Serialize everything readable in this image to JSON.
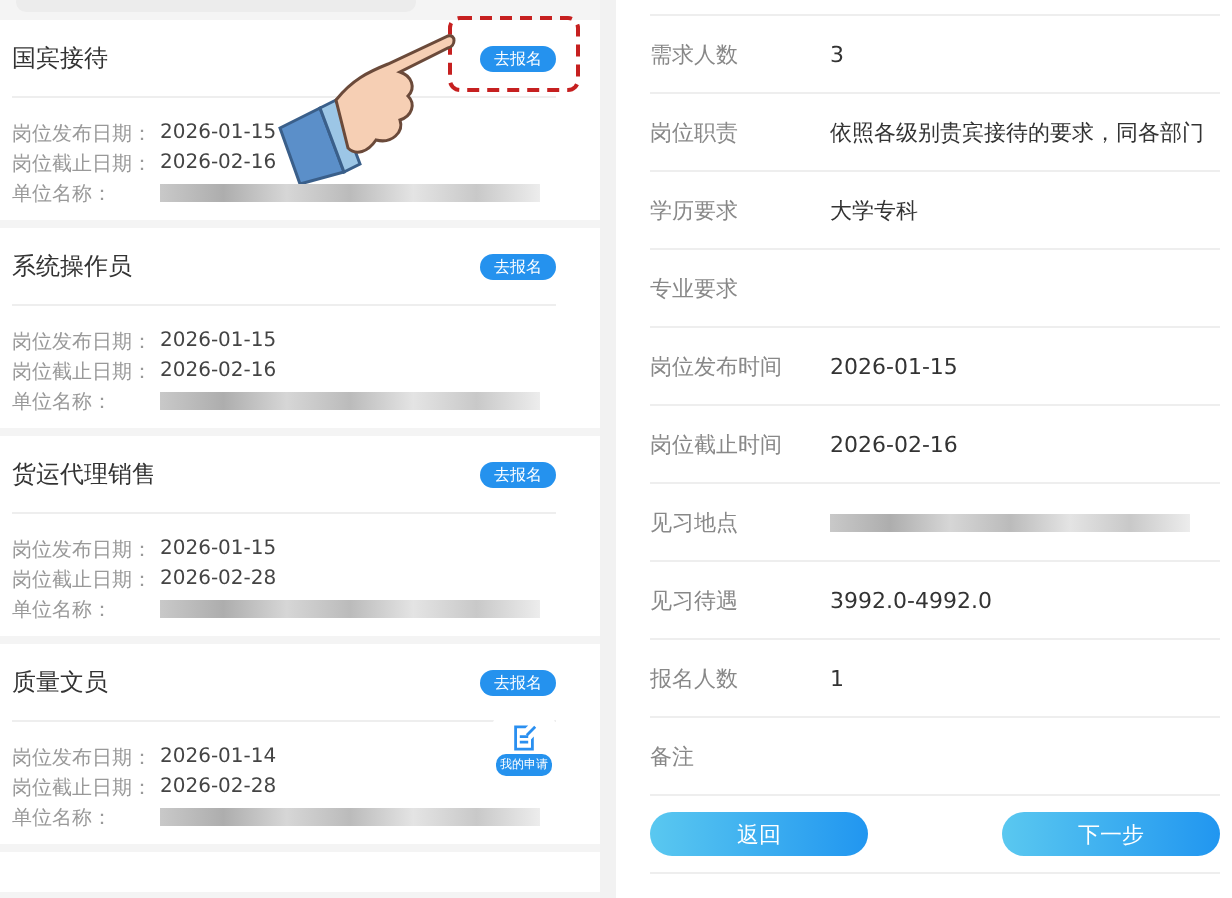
{
  "job_list": {
    "jobs": [
      {
        "title": "国宾接待",
        "publish_label": "岗位发布日期：",
        "publish_date": "2026-01-15",
        "deadline_label": "岗位截止日期：",
        "deadline_date": "2026-02-16",
        "unit_label": "单位名称：",
        "apply_label": "去报名",
        "highlighted": true
      },
      {
        "title": "系统操作员",
        "publish_label": "岗位发布日期：",
        "publish_date": "2026-01-15",
        "deadline_label": "岗位截止日期：",
        "deadline_date": "2026-02-16",
        "unit_label": "单位名称：",
        "apply_label": "去报名",
        "highlighted": false
      },
      {
        "title": "货运代理销售",
        "publish_label": "岗位发布日期：",
        "publish_date": "2026-01-15",
        "deadline_label": "岗位截止日期：",
        "deadline_date": "2026-02-28",
        "unit_label": "单位名称：",
        "apply_label": "去报名",
        "highlighted": false
      },
      {
        "title": "质量文员",
        "publish_label": "岗位发布日期：",
        "publish_date": "2026-01-14",
        "deadline_label": "岗位截止日期：",
        "deadline_date": "2026-02-28",
        "unit_label": "单位名称：",
        "apply_label": "去报名",
        "highlighted": false
      }
    ],
    "my_applications": "我的申请"
  },
  "detail": {
    "rows": [
      {
        "label": "需求人数",
        "value": "3",
        "kind": "text"
      },
      {
        "label": "岗位职责",
        "value": "依照各级别贵宾接待的要求，同各部门",
        "kind": "text"
      },
      {
        "label": "学历要求",
        "value": "大学专科",
        "kind": "text"
      },
      {
        "label": "专业要求",
        "kind": "empty"
      },
      {
        "label": "岗位发布时间",
        "value": "2026-01-15",
        "kind": "text"
      },
      {
        "label": "岗位截止时间",
        "value": "2026-02-16",
        "kind": "text"
      },
      {
        "label": "见习地点",
        "kind": "redacted"
      },
      {
        "label": "见习待遇",
        "value": "3992.0-4992.0",
        "kind": "text"
      },
      {
        "label": "报名人数",
        "value": "1",
        "kind": "text"
      },
      {
        "label": "备注",
        "kind": "empty"
      }
    ],
    "buttons": [
      "返回",
      "下一步"
    ]
  }
}
